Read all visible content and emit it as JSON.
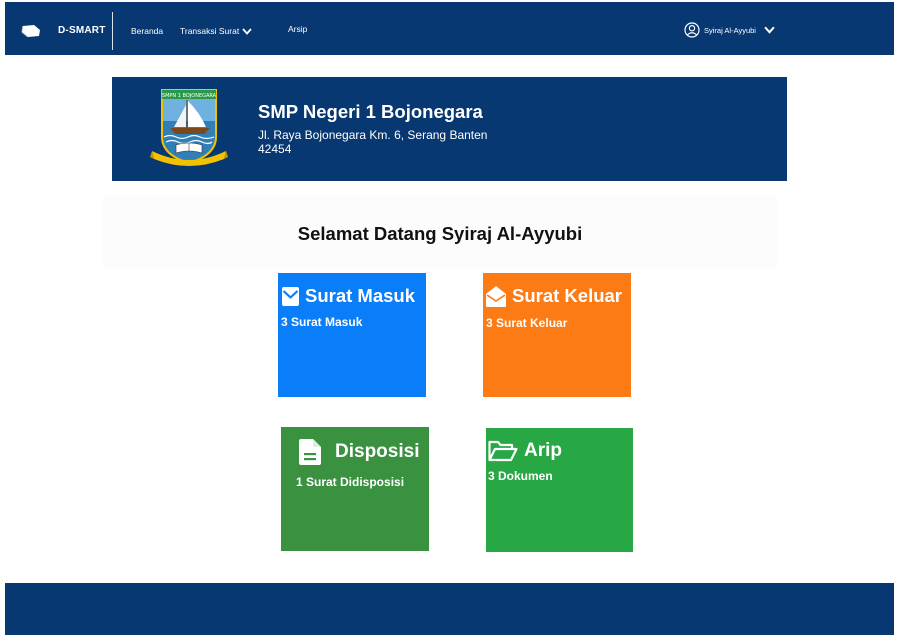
{
  "navbar": {
    "brand": "D-SMART",
    "links": {
      "beranda": "Beranda",
      "transaksi": "Transaksi Surat",
      "arsip": "Arsip"
    },
    "user_name": "Syiraj Al-Ayyubi",
    "icons": {
      "logo": "eraser-logo-icon",
      "dropdown": "chevron-down-icon",
      "user": "user-circle-icon"
    }
  },
  "banner": {
    "school_name": "SMP Negeri 1 Bojonegara",
    "address": "Jl. Raya Bojonegara Km. 6, Serang Banten 42454",
    "emblem_icon": "school-emblem-icon",
    "emblem_text": "SMPN 1 BOJONEGARA"
  },
  "welcome": "Selamat Datang Syiraj Al-Ayyubi",
  "cards": {
    "surat_masuk": {
      "title": "Surat Masuk",
      "count": "3 Surat Masuk",
      "icon": "envelope-icon"
    },
    "surat_keluar": {
      "title": "Surat Keluar",
      "count": "3 Surat Keluar",
      "icon": "envelope-open-icon"
    },
    "disposisi": {
      "title": "Disposisi",
      "count": "1 Surat Didisposisi",
      "icon": "document-icon"
    },
    "arip": {
      "title": "Arip",
      "count": "3 Dokumen",
      "icon": "folder-open-icon"
    }
  },
  "colors": {
    "navy": "#083872",
    "surat_masuk": "#0a7ef9",
    "surat_keluar": "#fd7b15",
    "disposisi": "#3a9140",
    "arip": "#28a745"
  }
}
